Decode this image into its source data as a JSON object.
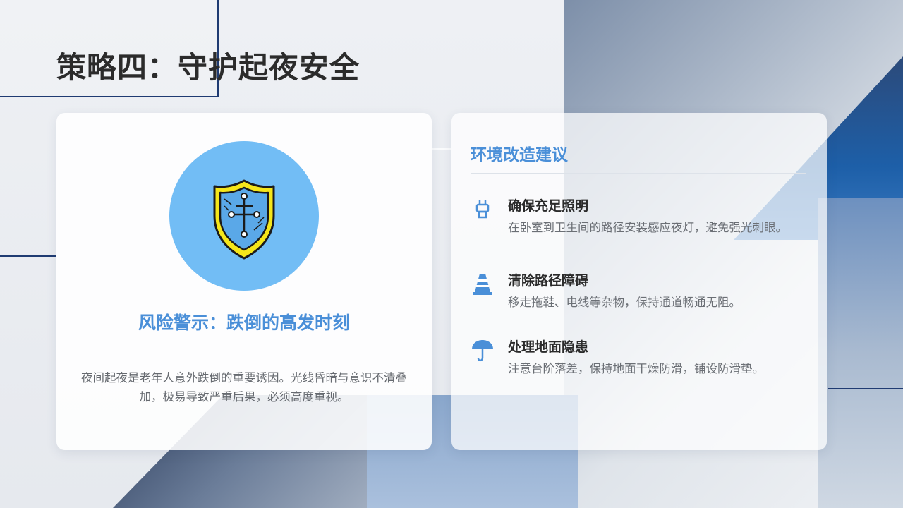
{
  "slide": {
    "title": "策略四：守护起夜安全"
  },
  "left_card": {
    "icon": "shield-icon",
    "heading": "风险警示：跌倒的高发时刻",
    "description": "夜间起夜是老年人意外跌倒的重要诱因。光线昏暗与意识不清叠加，极易导致严重后果，必须高度重视。"
  },
  "right_card": {
    "heading": "环境改造建议",
    "items": [
      {
        "icon": "plug-icon",
        "title": "确保充足照明",
        "text": "在卧室到卫生间的路径安装感应夜灯，避免强光刺眼。"
      },
      {
        "icon": "traffic-cone-icon",
        "title": "清除路径障碍",
        "text": "移走拖鞋、电线等杂物，保持通道畅通无阻。"
      },
      {
        "icon": "umbrella-icon",
        "title": "处理地面隐患",
        "text": "注意台阶落差，保持地面干燥防滑，铺设防滑垫。"
      }
    ]
  },
  "colors": {
    "accent": "#4a8fd8",
    "circle": "#72bdf5",
    "shield_yellow": "#f5e61a",
    "shield_blue": "#5aa8e8",
    "title_text": "#2b2b2b",
    "body_text": "#666a70"
  }
}
